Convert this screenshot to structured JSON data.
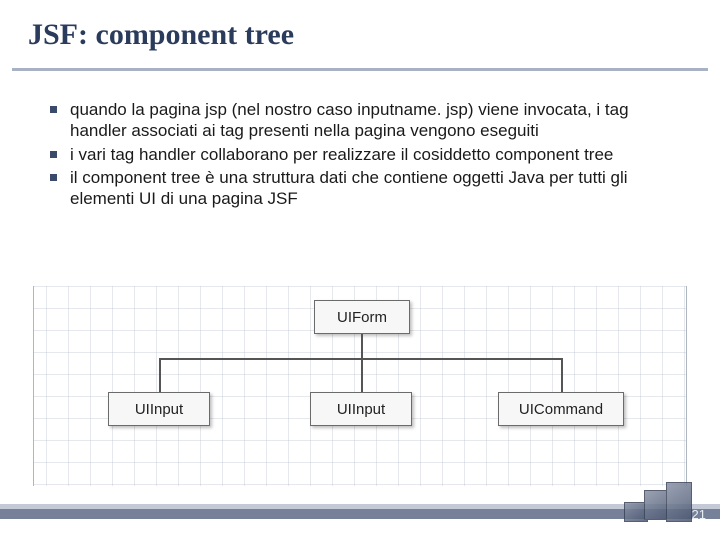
{
  "title": "JSF: component tree",
  "bullets": [
    "quando la pagina jsp (nel nostro caso inputname. jsp) viene invocata, i tag handler associati ai tag presenti nella pagina vengono eseguiti",
    "i vari tag handler collaborano per realizzare il cosiddetto component tree",
    "il component tree è una struttura dati che contiene oggetti Java per tutti gli elementi UI di una pagina JSF"
  ],
  "chart_data": {
    "type": "diagram",
    "title": "",
    "nodes": {
      "root": "UIForm",
      "children": [
        "UIInput",
        "UIInput",
        "UICommand"
      ]
    }
  },
  "page_number": "21"
}
